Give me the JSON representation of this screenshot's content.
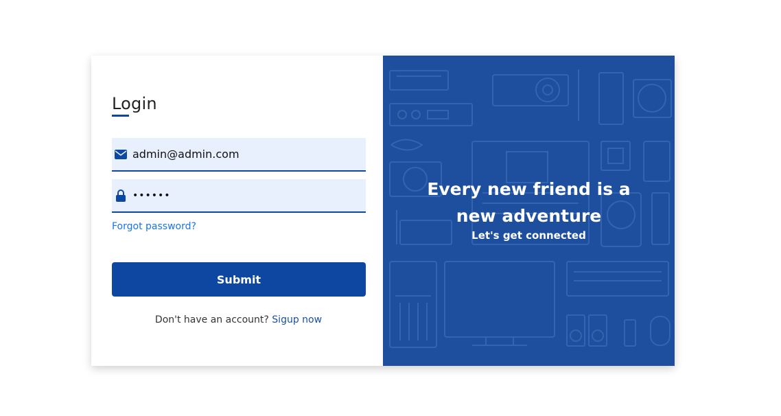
{
  "login": {
    "title": "Login",
    "email_value": "admin@admin.com",
    "password_value": "••••••",
    "forgot_label": "Forgot password?",
    "submit_label": "Submit",
    "signup_prompt": "Don't have an account?",
    "signup_link": "Sigup now"
  },
  "promo": {
    "heading_line1": "Every new friend is a",
    "heading_line2": "new adventure",
    "subheading": "Let's get connected"
  },
  "icons": {
    "email": "envelope-icon",
    "password": "lock-icon"
  },
  "colors": {
    "accent": "#0d47a1",
    "input_bg": "#e8f0fe",
    "link": "#1a73e8",
    "panel_bg": "#1d4f9e"
  }
}
